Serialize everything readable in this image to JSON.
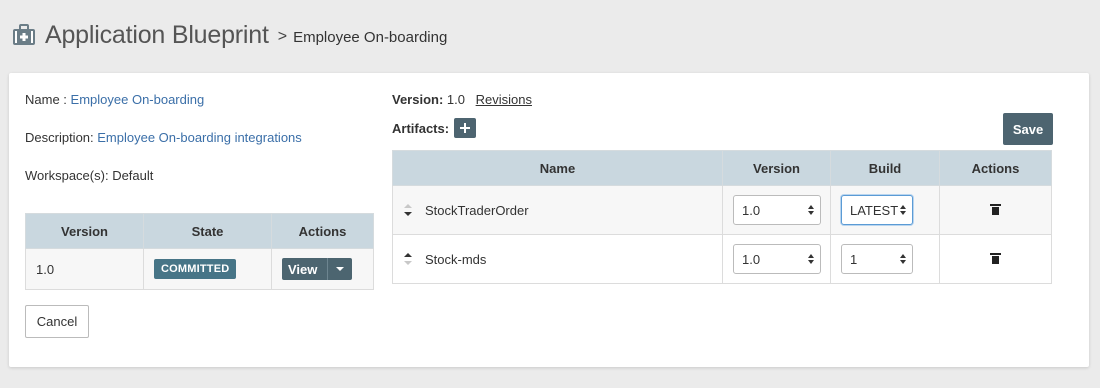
{
  "header": {
    "title": "Application Blueprint",
    "separator": ">",
    "current": "Employee On-boarding",
    "icon": "briefcase-icon"
  },
  "details": {
    "name_label": "Name :",
    "name_value": "Employee On-boarding",
    "description_label": "Description:",
    "description_value": "Employee On-boarding integrations",
    "workspace_label": "Workspace(s):",
    "workspace_value": "Default"
  },
  "versions_table": {
    "headers": [
      "Version",
      "State",
      "Actions"
    ],
    "rows": [
      {
        "version": "1.0",
        "state": "COMMITTED",
        "action": "View"
      }
    ]
  },
  "cancel_label": "Cancel",
  "version_info": {
    "label": "Version:",
    "value": "1.0",
    "revisions_link": "Revisions"
  },
  "artifacts_label": "Artifacts:",
  "save_label": "Save",
  "artifacts_table": {
    "headers": [
      "Name",
      "Version",
      "Build",
      "Actions"
    ],
    "rows": [
      {
        "name": "StockTraderOrder",
        "version": "1.0",
        "build": "LATEST"
      },
      {
        "name": "Stock-mds",
        "version": "1.0",
        "build": "1"
      }
    ]
  },
  "colors": {
    "background": "#ebebeb",
    "link": "#3b6fa8",
    "header_row": "#c9d7df",
    "button_dark": "#4d6470",
    "badge": "#477587"
  }
}
